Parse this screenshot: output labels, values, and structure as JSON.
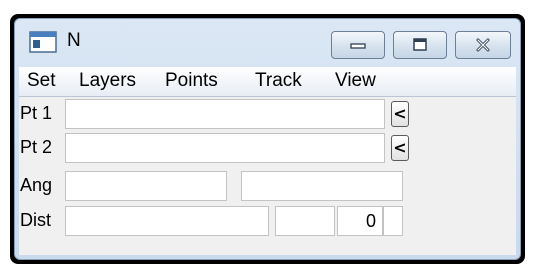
{
  "top_fragment": {
    "before": "",
    "link": "",
    "after": ""
  },
  "window": {
    "title": "N",
    "icons": {
      "app": "app-window-icon",
      "minimize": "minimize-icon",
      "maximize": "maximize-icon",
      "close": "close-icon"
    }
  },
  "menu": {
    "items": [
      "Set",
      "Layers",
      "Points",
      "Track",
      "View"
    ]
  },
  "rows": {
    "pt1": {
      "label": "Pt 1",
      "value": "",
      "button": "<"
    },
    "pt2": {
      "label": "Pt 2",
      "value": "",
      "button": "<"
    },
    "ang": {
      "label": "Ang",
      "value1": "",
      "value2": ""
    },
    "dist": {
      "label": "Dist",
      "value1": "",
      "value2": "",
      "value3": "0",
      "value4": ""
    }
  }
}
